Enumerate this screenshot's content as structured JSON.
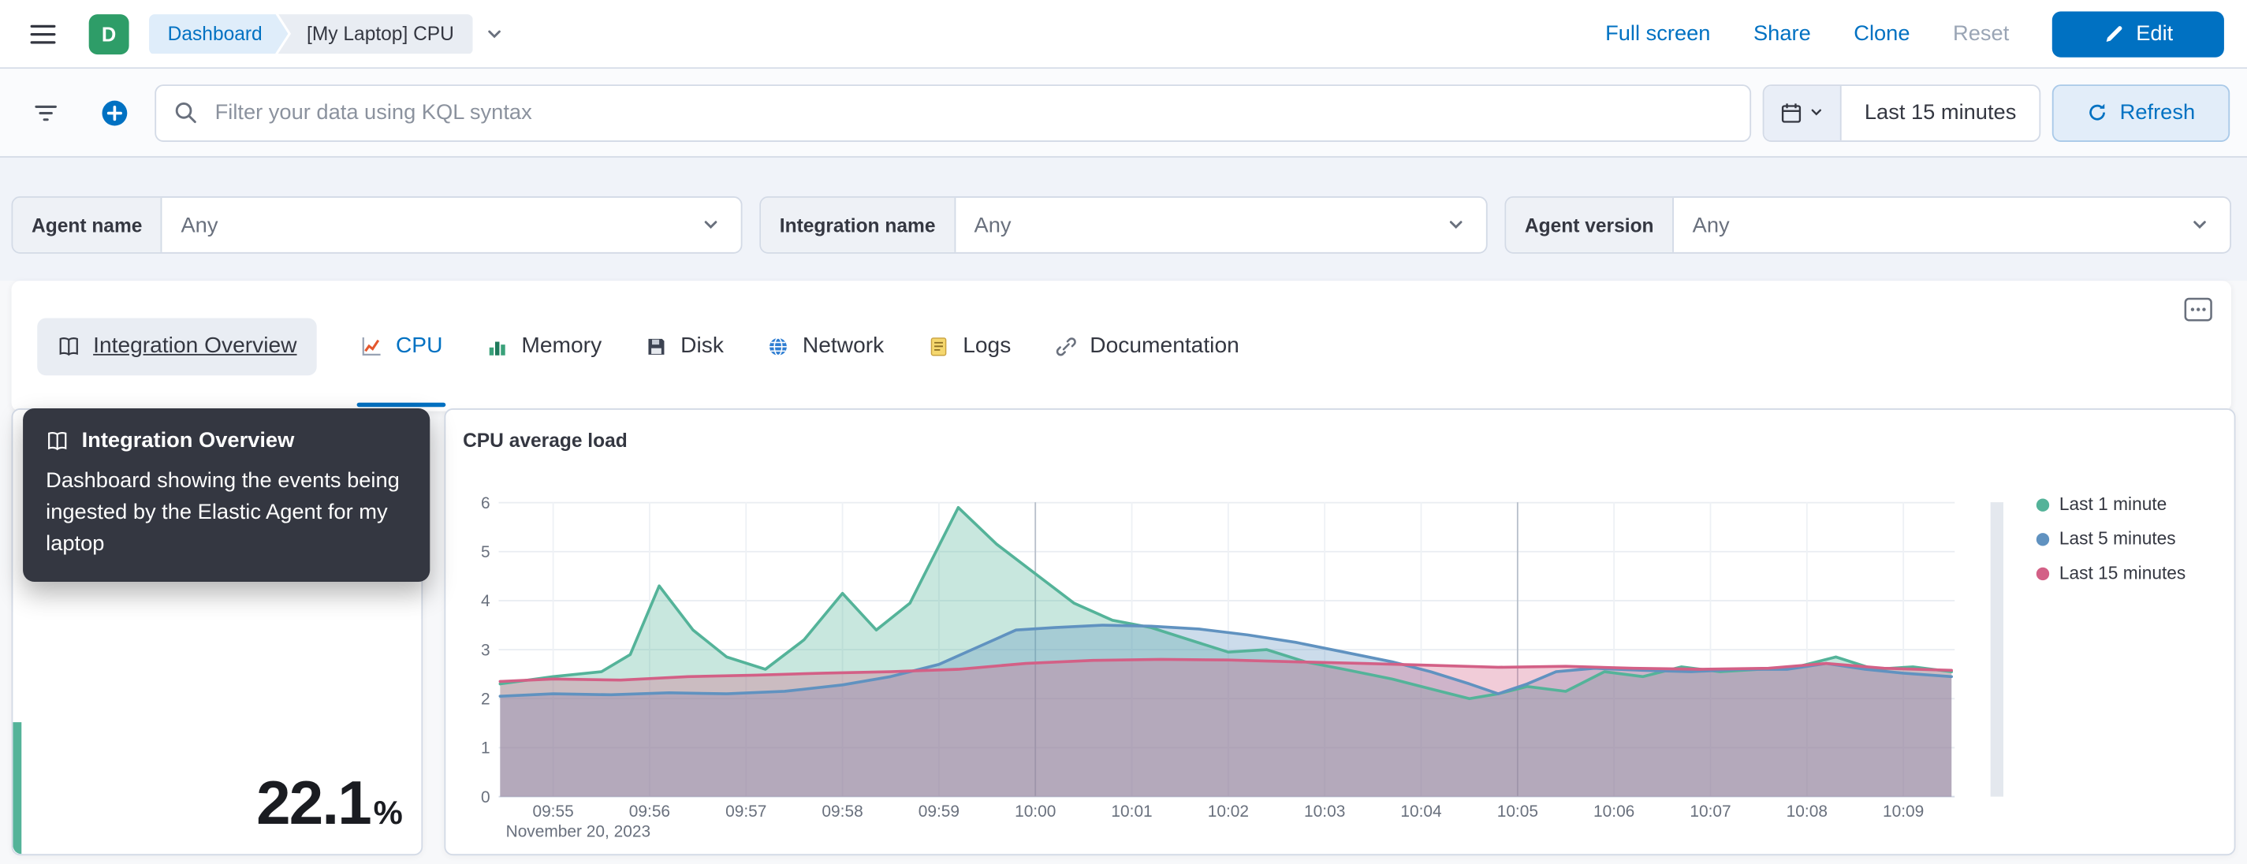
{
  "colors": {
    "primary": "#0071c2",
    "link": "#0071c2",
    "text": "#343741",
    "subdued": "#69707d",
    "border": "#d3dae6",
    "avatar_bg": "#2e9d68",
    "tooltip_bg": "#343741",
    "metric_accent": "#54b399",
    "page_bg": "#f7f8fa",
    "controls_bg": "#f0f3f9"
  },
  "header": {
    "space_initial": "D",
    "breadcrumbs": [
      {
        "label": "Dashboard"
      },
      {
        "label": "[My Laptop] CPU"
      }
    ],
    "actions": [
      "Full screen",
      "Share",
      "Clone",
      "Reset"
    ],
    "edit_label": "Edit"
  },
  "query_bar": {
    "placeholder": "Filter your data using KQL syntax",
    "time_range": "Last 15 minutes",
    "refresh_label": "Refresh"
  },
  "controls": [
    {
      "label": "Agent name",
      "value": "Any"
    },
    {
      "label": "Integration name",
      "value": "Any"
    },
    {
      "label": "Agent version",
      "value": "Any"
    }
  ],
  "tabs": [
    {
      "label": "Integration Overview",
      "icon": "book-icon",
      "state": "hovered"
    },
    {
      "label": "CPU",
      "icon": "line-chart-icon",
      "state": "selected"
    },
    {
      "label": "Memory",
      "icon": "bar-chart-icon"
    },
    {
      "label": "Disk",
      "icon": "disk-icon"
    },
    {
      "label": "Network",
      "icon": "globe-icon"
    },
    {
      "label": "Logs",
      "icon": "logs-icon"
    },
    {
      "label": "Documentation",
      "icon": "link-icon"
    }
  ],
  "tooltip": {
    "title": "Integration Overview",
    "body": "Dashboard showing the events being ingested by the Elastic Agent for my laptop"
  },
  "metric": {
    "value": "22.1",
    "unit": "%"
  },
  "chart_data": {
    "type": "area",
    "title": "CPU average load",
    "x_context_label": "November 20, 2023",
    "x_tick_labels": [
      "09:55",
      "09:56",
      "09:57",
      "09:58",
      "09:59",
      "10:00",
      "10:01",
      "10:02",
      "10:03",
      "10:04",
      "10:05",
      "10:06",
      "10:07",
      "10:08",
      "10:09"
    ],
    "x_unit": "minutes relative to 09:55",
    "y_ticks": [
      0,
      1,
      2,
      3,
      4,
      5,
      6
    ],
    "ylim": [
      0,
      6
    ],
    "grid": true,
    "legend_position": "right",
    "series": [
      {
        "name": "Last 1 minute",
        "color": "#54B399",
        "points": [
          [
            -0.55,
            2.3
          ],
          [
            0,
            2.45
          ],
          [
            0.5,
            2.55
          ],
          [
            0.8,
            2.9
          ],
          [
            1.1,
            4.3
          ],
          [
            1.45,
            3.4
          ],
          [
            1.8,
            2.85
          ],
          [
            2.2,
            2.6
          ],
          [
            2.6,
            3.2
          ],
          [
            3.0,
            4.15
          ],
          [
            3.35,
            3.4
          ],
          [
            3.7,
            3.95
          ],
          [
            4.2,
            5.9
          ],
          [
            4.6,
            5.15
          ],
          [
            5.0,
            4.55
          ],
          [
            5.4,
            3.95
          ],
          [
            5.8,
            3.6
          ],
          [
            6.2,
            3.45
          ],
          [
            6.6,
            3.2
          ],
          [
            7.0,
            2.95
          ],
          [
            7.4,
            3.0
          ],
          [
            7.8,
            2.75
          ],
          [
            8.2,
            2.6
          ],
          [
            8.7,
            2.4
          ],
          [
            9.1,
            2.2
          ],
          [
            9.5,
            2.0
          ],
          [
            9.8,
            2.1
          ],
          [
            10.1,
            2.25
          ],
          [
            10.5,
            2.15
          ],
          [
            10.9,
            2.55
          ],
          [
            11.3,
            2.45
          ],
          [
            11.7,
            2.65
          ],
          [
            12.1,
            2.55
          ],
          [
            12.5,
            2.6
          ],
          [
            12.9,
            2.65
          ],
          [
            13.3,
            2.85
          ],
          [
            13.7,
            2.6
          ],
          [
            14.1,
            2.65
          ],
          [
            14.5,
            2.55
          ]
        ]
      },
      {
        "name": "Last 5 minutes",
        "color": "#6092C0",
        "points": [
          [
            -0.55,
            2.05
          ],
          [
            0,
            2.1
          ],
          [
            0.6,
            2.08
          ],
          [
            1.2,
            2.12
          ],
          [
            1.8,
            2.1
          ],
          [
            2.4,
            2.15
          ],
          [
            3.0,
            2.28
          ],
          [
            3.5,
            2.45
          ],
          [
            4.0,
            2.7
          ],
          [
            4.4,
            3.05
          ],
          [
            4.8,
            3.4
          ],
          [
            5.2,
            3.45
          ],
          [
            5.7,
            3.5
          ],
          [
            6.2,
            3.48
          ],
          [
            6.7,
            3.42
          ],
          [
            7.2,
            3.3
          ],
          [
            7.7,
            3.15
          ],
          [
            8.2,
            2.95
          ],
          [
            8.7,
            2.75
          ],
          [
            9.1,
            2.55
          ],
          [
            9.5,
            2.3
          ],
          [
            9.8,
            2.1
          ],
          [
            10.1,
            2.3
          ],
          [
            10.4,
            2.55
          ],
          [
            10.8,
            2.62
          ],
          [
            11.3,
            2.58
          ],
          [
            11.8,
            2.55
          ],
          [
            12.3,
            2.6
          ],
          [
            12.8,
            2.6
          ],
          [
            13.2,
            2.72
          ],
          [
            13.6,
            2.6
          ],
          [
            14.0,
            2.52
          ],
          [
            14.5,
            2.45
          ]
        ]
      },
      {
        "name": "Last 15 minutes",
        "color": "#D36086",
        "points": [
          [
            -0.55,
            2.35
          ],
          [
            0,
            2.4
          ],
          [
            0.7,
            2.38
          ],
          [
            1.4,
            2.45
          ],
          [
            2.1,
            2.48
          ],
          [
            2.8,
            2.52
          ],
          [
            3.5,
            2.55
          ],
          [
            4.2,
            2.6
          ],
          [
            4.9,
            2.72
          ],
          [
            5.6,
            2.78
          ],
          [
            6.3,
            2.8
          ],
          [
            7.0,
            2.79
          ],
          [
            7.7,
            2.75
          ],
          [
            8.4,
            2.72
          ],
          [
            9.1,
            2.68
          ],
          [
            9.8,
            2.64
          ],
          [
            10.5,
            2.66
          ],
          [
            11.2,
            2.62
          ],
          [
            11.9,
            2.6
          ],
          [
            12.6,
            2.62
          ],
          [
            13.2,
            2.72
          ],
          [
            13.8,
            2.62
          ],
          [
            14.5,
            2.58
          ]
        ]
      }
    ]
  }
}
